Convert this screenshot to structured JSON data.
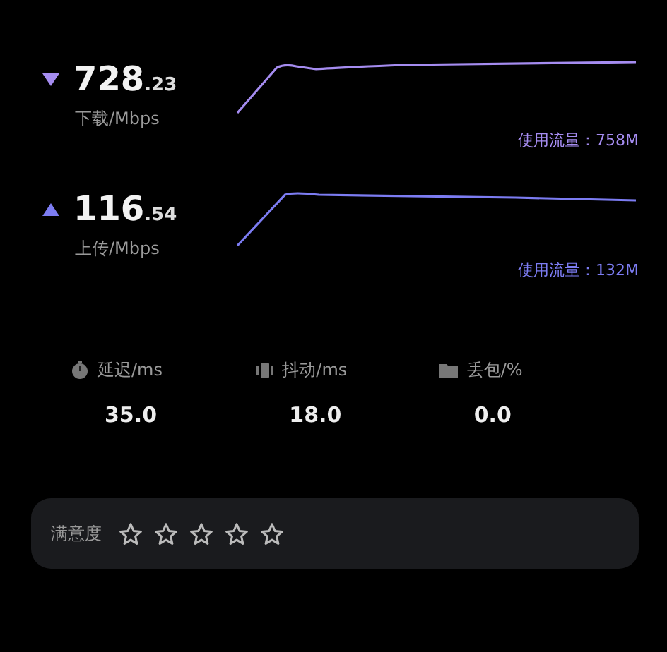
{
  "speeds": [
    {
      "kind": "download",
      "color": "#a58cf0",
      "value": "728",
      "decimal": ".23",
      "label": "下载/Mbps",
      "usage": "使用流量：758M"
    },
    {
      "kind": "upload",
      "color": "#7c7cf2",
      "value": "116",
      "decimal": ".54",
      "label": "上传/Mbps",
      "usage": "使用流量：132M"
    }
  ],
  "metrics": [
    {
      "kind": "latency",
      "label": "延迟/ms",
      "value": "35.0"
    },
    {
      "kind": "jitter",
      "label": "抖动/ms",
      "value": "18.0"
    },
    {
      "kind": "loss",
      "label": "丢包/%",
      "value": "0.0"
    }
  ],
  "rating": {
    "label": "满意度",
    "stars": 0
  }
}
